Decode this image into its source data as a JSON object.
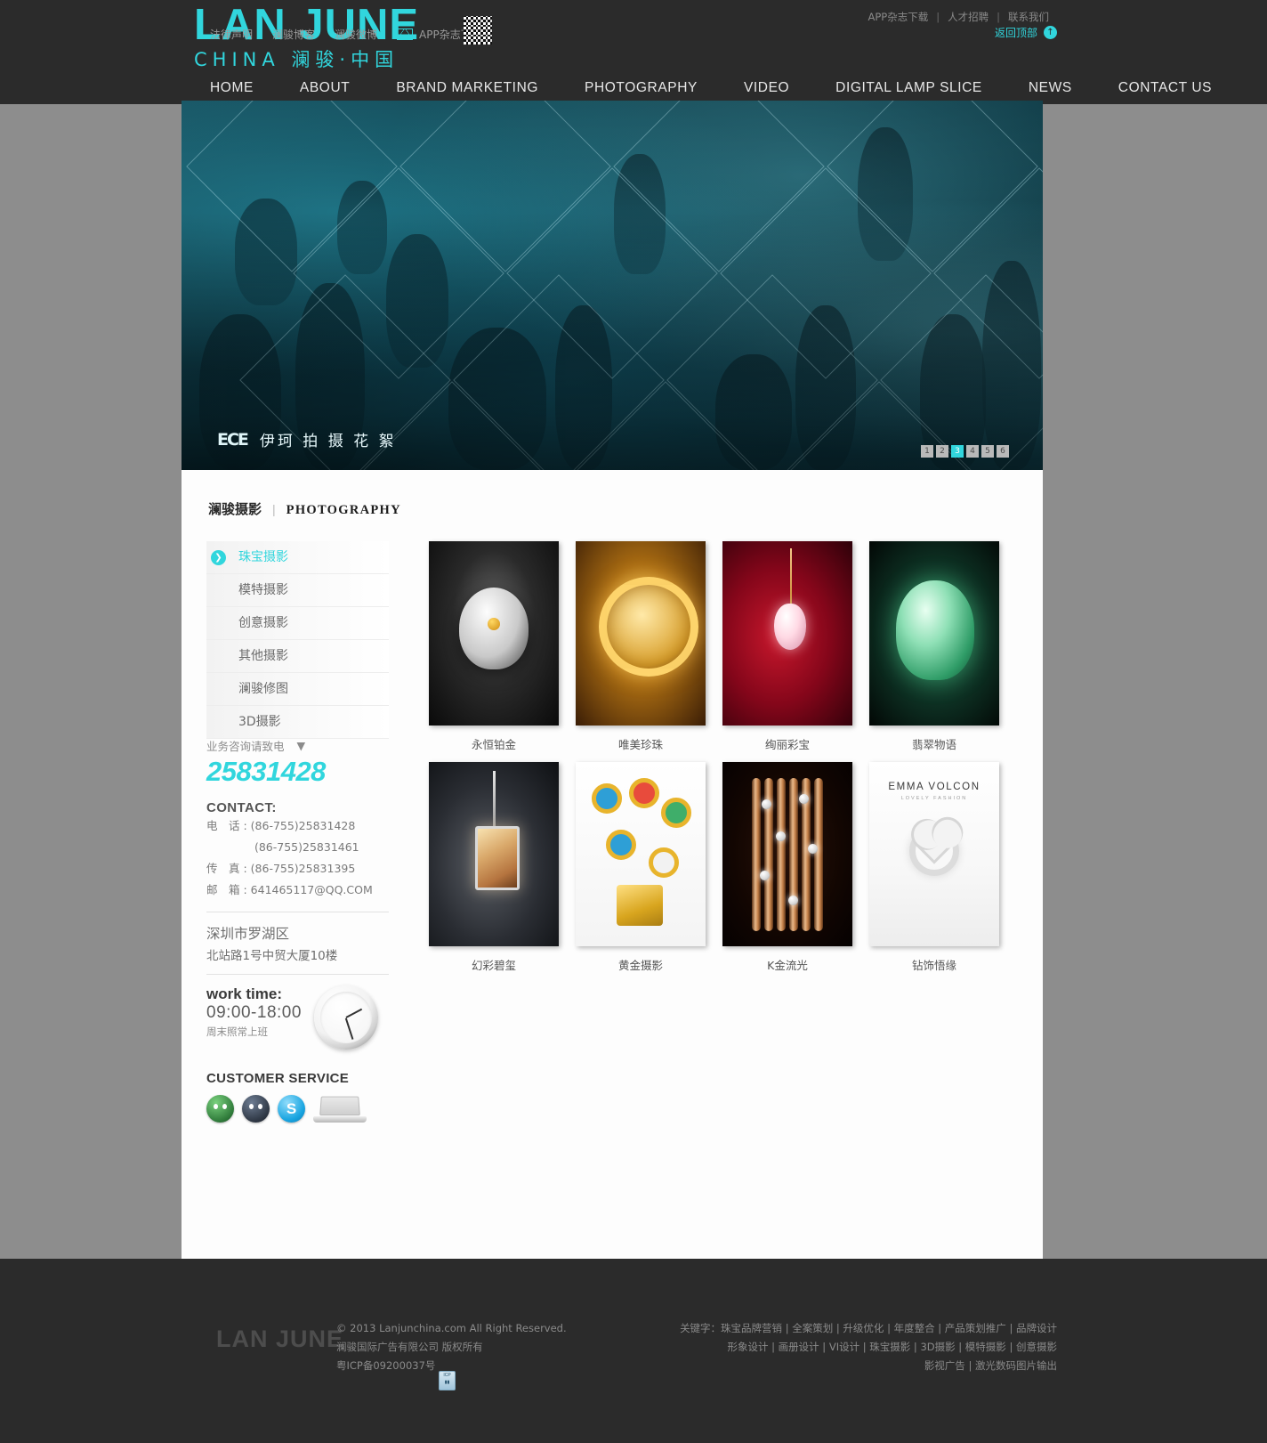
{
  "header": {
    "logo_main": "LAN JUNE",
    "logo_sub": "CHINA 澜骏·中国",
    "top_links": [
      "APP杂志下载",
      "人才招聘",
      "联系我们"
    ],
    "nav": [
      "HOME",
      "ABOUT",
      "BRAND MARKETING",
      "PHOTOGRAPHY",
      "VIDEO",
      "DIGITAL LAMP SLICE",
      "NEWS",
      "CONTACT US"
    ]
  },
  "banner": {
    "mark": "ECE",
    "caption": "伊珂  拍 摄 花 絮",
    "slides": [
      "1",
      "2",
      "3",
      "4",
      "5",
      "6"
    ],
    "active_slide": "3"
  },
  "section": {
    "title_cn": "澜骏摄影",
    "title_divider": "|",
    "title_en": "PHOTOGRAPHY"
  },
  "sidebar": {
    "items": [
      {
        "label": "珠宝摄影",
        "active": true
      },
      {
        "label": "模特摄影",
        "active": false
      },
      {
        "label": "创意摄影",
        "active": false
      },
      {
        "label": "其他摄影",
        "active": false
      },
      {
        "label": "澜骏修图",
        "active": false
      },
      {
        "label": "3D摄影",
        "active": false
      }
    ],
    "call_label": "业务咨询请致电",
    "call_number": "25831428",
    "contact_head": "CONTACT:",
    "contact_lines": [
      "电　话 : (86-755)25831428",
      "　　　　 (86-755)25831461",
      "传　真 : (86-755)25831395",
      "邮　箱 : 641465117@QQ.COM"
    ],
    "address_line1": "深圳市罗湖区",
    "address_line2": "北站路1号中贸大厦10楼",
    "worktime_title": "work time:",
    "worktime_hours": "09:00-18:00",
    "worktime_note": "周末照常上班",
    "customer_service_title": "CUSTOMER SERVICE",
    "service_icons": [
      "qq-green-icon",
      "qq-dark-icon",
      "skype-icon",
      "laptop-icon"
    ]
  },
  "gallery": {
    "items": [
      {
        "caption": "永恒铂金",
        "art": "t1"
      },
      {
        "caption": "唯美珍珠",
        "art": "t2"
      },
      {
        "caption": "绚丽彩宝",
        "art": "t3"
      },
      {
        "caption": "翡翠物语",
        "art": "t4"
      },
      {
        "caption": "幻彩碧玺",
        "art": "t5"
      },
      {
        "caption": "黄金摄影",
        "art": "t6"
      },
      {
        "caption": "K金流光",
        "art": "t7"
      },
      {
        "caption": "钻饰悟缘",
        "art": "t8"
      }
    ],
    "card8_brand": "EMMA VOLCON",
    "card8_brand_sub": "LOVELY FASHION"
  },
  "footer": {
    "links": [
      "法律声明",
      "澜骏博客",
      "澜骏微博"
    ],
    "app_link": "APP杂志下载",
    "back_to_top": "返回顶部",
    "back_to_top_icon": "↑",
    "logo": "LAN JUNE",
    "copyright_line1": "© 2013 Lanjunchina.com All Right Reserved.",
    "copyright_line2": "澜骏国际广告有限公司 版权所有",
    "copyright_line3": "粤ICP备09200037号",
    "keywords_line1": "关键字：珠宝品牌营销 | 全案策划 | 升级优化 | 年度整合 | 产品策划推广 | 品牌设计",
    "keywords_line2": "形象设计 | 画册设计 | VI设计 | 珠宝摄影 | 3D摄影 | 模特摄影 | 创意摄影",
    "keywords_line3": "影视广告 | 激光数码图片输出"
  },
  "colors": {
    "accent": "#31d6dd",
    "header_bg": "#2b2b2b",
    "content_bg": "#fdfdfd",
    "page_bg": "#8d8d8d"
  }
}
